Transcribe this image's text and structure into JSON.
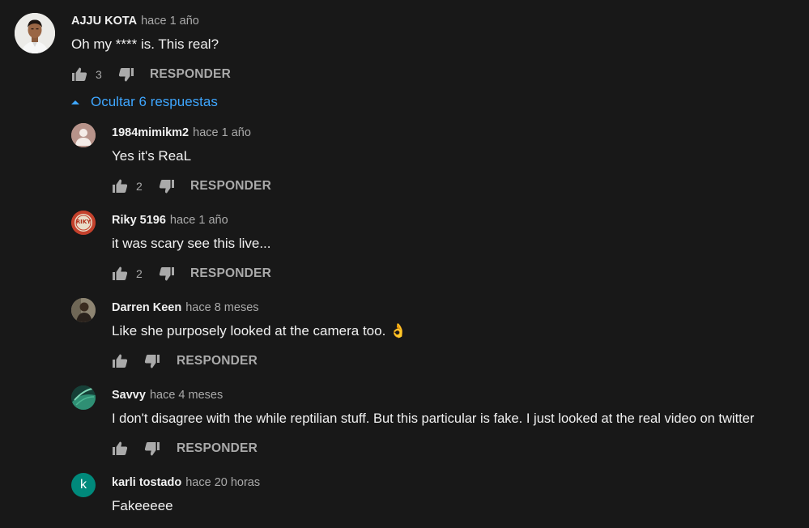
{
  "main_comment": {
    "author": "AJJU KOTA",
    "time": "hace 1 año",
    "text": "Oh my **** is. This real?",
    "likes": "3",
    "reply_label": "RESPONDER"
  },
  "replies_toggle": {
    "label": "Ocultar 6 respuestas"
  },
  "replies": [
    {
      "author": "1984mimikm2",
      "time": "hace 1 año",
      "text": "Yes it's ReaL",
      "likes": "2",
      "reply_label": "RESPONDER",
      "avatar_icon": "default-person-avatar"
    },
    {
      "author": "Riky 5196",
      "time": "hace 1 año",
      "text": "it was scary see this live...",
      "likes": "2",
      "reply_label": "RESPONDER",
      "avatar_icon": "riky-logo-avatar",
      "avatar_text": "RIKY"
    },
    {
      "author": "Darren Keen",
      "time": "hace 8 meses",
      "text": "Like she purposely looked at the camera too.",
      "emoji": "👌",
      "likes": "",
      "reply_label": "RESPONDER",
      "avatar_icon": "photo-avatar"
    },
    {
      "author": "Savvy",
      "time": "hace 4 meses",
      "text": "I don't disagree with the while reptilian stuff. But this particular is fake. I just looked at the real video on twitter",
      "likes": "",
      "reply_label": "RESPONDER",
      "avatar_icon": "green-abstract-avatar"
    },
    {
      "author": "karli tostado",
      "time": "hace 20 horas",
      "text": "Fakeeeee",
      "avatar_icon": "letter-avatar",
      "avatar_letter": "k"
    }
  ],
  "colors": {
    "background": "#181818",
    "text_primary": "#f1f1f1",
    "text_secondary": "#aaaaaa",
    "link_blue": "#3ea6ff",
    "letter_avatar_bg": "#00897b"
  }
}
